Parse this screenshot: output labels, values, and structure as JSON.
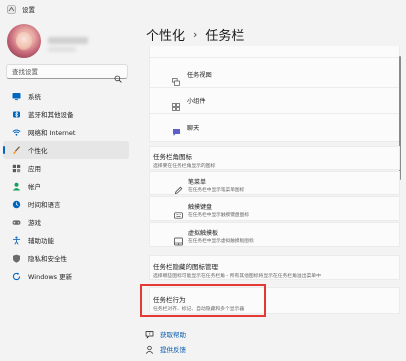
{
  "window": {
    "title": "设置"
  },
  "sidebar": {
    "search_placeholder": "查找设置",
    "items": [
      {
        "label": "系统",
        "icon": "monitor-icon",
        "color": "#0067c0"
      },
      {
        "label": "蓝牙和其他设备",
        "icon": "bluetooth-icon",
        "color": "#0067c0"
      },
      {
        "label": "网络和 Internet",
        "icon": "wifi-icon",
        "color": "#0067c0"
      },
      {
        "label": "个性化",
        "icon": "brush-icon",
        "color": "#f7a21b",
        "active": true
      },
      {
        "label": "应用",
        "icon": "apps-icon",
        "color": "#5a5a5a"
      },
      {
        "label": "帐户",
        "icon": "person-icon",
        "color": "#17a05d"
      },
      {
        "label": "时间和语言",
        "icon": "globe-clock-icon",
        "color": "#0067c0"
      },
      {
        "label": "游戏",
        "icon": "gamepad-icon",
        "color": "#6b6b6b"
      },
      {
        "label": "辅助功能",
        "icon": "accessibility-icon",
        "color": "#1a6fc4"
      },
      {
        "label": "隐私和安全性",
        "icon": "shield-icon",
        "color": "#6b6b6b"
      },
      {
        "label": "Windows 更新",
        "icon": "update-icon",
        "color": "#0067c0"
      }
    ]
  },
  "breadcrumb": {
    "parent": "个性化",
    "separator": "›",
    "current": "任务栏"
  },
  "taskbar_items": [
    {
      "label": "任务视图",
      "icon": "task-view-icon"
    },
    {
      "label": "小组件",
      "icon": "widgets-icon"
    },
    {
      "label": "聊天",
      "icon": "chat-icon"
    }
  ],
  "corner_icons": {
    "title": "任务栏角图标",
    "description": "选择要在任务栏角显示的图标",
    "items": [
      {
        "label": "笔菜单",
        "description": "在任务栏中显示笔菜单图标",
        "icon": "pen-icon"
      },
      {
        "label": "触摸键盘",
        "description": "在任务栏中显示触摸键盘图标",
        "icon": "keyboard-icon"
      },
      {
        "label": "虚拟触摸板",
        "description": "在任务栏中显示虚拟触摸板图标",
        "icon": "touchpad-icon"
      }
    ]
  },
  "overflow": {
    "title": "任务栏隐藏的图标管理",
    "description": "选择哪些图标可能显示在任务栏角 - 所有其他图标将显示在任务栏角溢出菜单中"
  },
  "behavior": {
    "title": "任务栏行为",
    "description": "任务栏对齐、标记、自动隐藏和多个显示器"
  },
  "help": {
    "get_help": "获取帮助",
    "feedback": "提供反馈"
  },
  "colors": {
    "accent": "#0067c0",
    "highlight": "#e53935"
  }
}
